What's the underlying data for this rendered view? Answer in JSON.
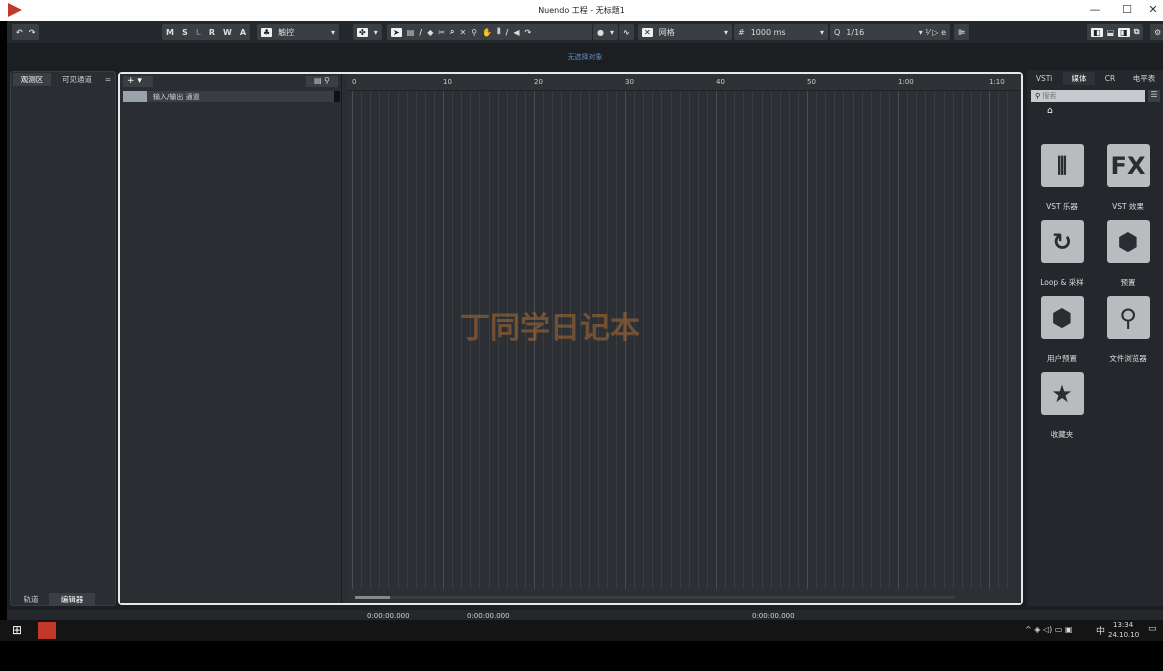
{
  "window": {
    "title": "Nuendo 工程 - 无标题1",
    "minimize": "—",
    "maximize": "☐",
    "close": "✕"
  },
  "toolbar": {
    "undo": "↶",
    "redo": "↷",
    "modes": [
      "M",
      "S",
      "L",
      "R",
      "W",
      "A"
    ],
    "automation_mode": "触控",
    "snap_type": "网格",
    "grid_value": "1000 ms",
    "quantize": "1/16"
  },
  "info_line": "无选择对象",
  "left_panel": {
    "tabs": [
      "观测区",
      "可见通道"
    ],
    "menu": "=",
    "bottom_tabs": [
      "轨道",
      "编辑器"
    ]
  },
  "tracklist": {
    "add": "+",
    "tracks": [
      "输入/输出 通道"
    ]
  },
  "ruler": {
    "labels": [
      "0",
      "10",
      "20",
      "30",
      "40",
      "50",
      "1:00",
      "1:10"
    ]
  },
  "right_panel": {
    "tabs": [
      "VSTi",
      "媒体",
      "CR",
      "电平表"
    ],
    "active_tab": "媒体",
    "search_placeholder": "搜索",
    "items": [
      {
        "label": "VST 乐器",
        "icon": "piano-icon"
      },
      {
        "label": "VST 效果",
        "icon": "fx-icon"
      },
      {
        "label": "Loop & 采样",
        "icon": "loop-icon"
      },
      {
        "label": "预置",
        "icon": "hexagons-icon"
      },
      {
        "label": "用户预置",
        "icon": "user-preset-icon"
      },
      {
        "label": "文件浏览器",
        "icon": "file-browser-icon"
      },
      {
        "label": "收藏夹",
        "icon": "star-icon"
      }
    ]
  },
  "transport": {
    "time1": "0:00:00.000",
    "time2": "0:00:00.000",
    "time3": "0:00:00.000"
  },
  "watermark": "丁同学日记本",
  "taskbar": {
    "time": "13:34",
    "date": "24.10.10",
    "ime": "中"
  }
}
